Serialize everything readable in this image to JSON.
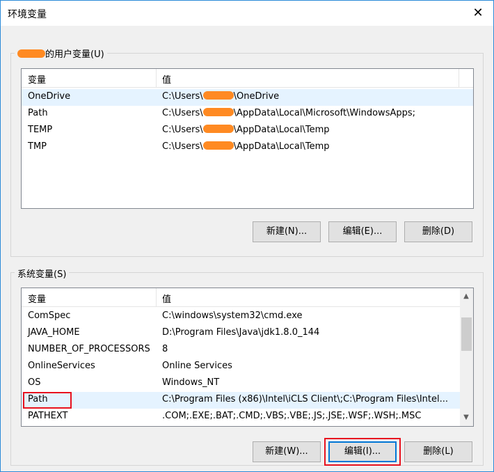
{
  "window": {
    "title": "环境变量",
    "close_glyph": "✕"
  },
  "user_group": {
    "label_suffix": "的用户变量(U)",
    "columns": [
      "变量",
      "值"
    ],
    "rows": [
      {
        "name": "OneDrive",
        "value_pre": "C:\\Users\\",
        "value_post": "\\OneDrive"
      },
      {
        "name": "Path",
        "value_pre": "C:\\Users\\",
        "value_post": "\\AppData\\Local\\Microsoft\\WindowsApps;"
      },
      {
        "name": "TEMP",
        "value_pre": "C:\\Users\\",
        "value_post": "\\AppData\\Local\\Temp"
      },
      {
        "name": "TMP",
        "value_pre": "C:\\Users\\",
        "value_post": "\\AppData\\Local\\Temp"
      }
    ],
    "buttons": {
      "new": "新建(N)...",
      "edit": "编辑(E)...",
      "delete": "删除(D)"
    }
  },
  "system_group": {
    "label": "系统变量(S)",
    "columns": [
      "变量",
      "值"
    ],
    "rows": [
      {
        "name": "ComSpec",
        "value": "C:\\windows\\system32\\cmd.exe"
      },
      {
        "name": "JAVA_HOME",
        "value": "D:\\Program Files\\Java\\jdk1.8.0_144"
      },
      {
        "name": "NUMBER_OF_PROCESSORS",
        "value": "8"
      },
      {
        "name": "OnlineServices",
        "value": "Online Services"
      },
      {
        "name": "OS",
        "value": "Windows_NT"
      },
      {
        "name": "Path",
        "value": "C:\\Program Files (x86)\\Intel\\iCLS Client\\;C:\\Program Files\\Intel..."
      },
      {
        "name": "PATHEXT",
        "value": ".COM;.EXE;.BAT;.CMD;.VBS;.VBE;.JS;.JSE;.WSF;.WSH;.MSC"
      }
    ],
    "buttons": {
      "new": "新建(W)...",
      "edit": "编辑(I)...",
      "delete": "删除(L)"
    }
  },
  "colors": {
    "highlight": "#e8121f",
    "redaction": "#ff8a22",
    "selected_row": "#e5f3ff"
  },
  "icons": {
    "close": "close-icon",
    "scroll_up": "chevron-up-icon",
    "scroll_down": "chevron-down-icon"
  }
}
